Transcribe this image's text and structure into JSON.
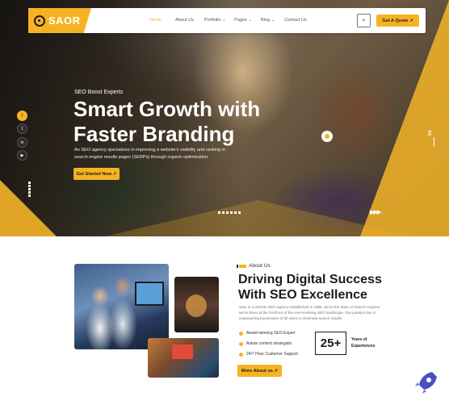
{
  "nav": {
    "logo_text": "SAOR",
    "items": [
      {
        "label": "Home",
        "active": true
      },
      {
        "label": "About Us",
        "active": false
      },
      {
        "label": "Portfolio",
        "active": false
      },
      {
        "label": "Pages",
        "active": false
      },
      {
        "label": "Blog",
        "active": false
      },
      {
        "label": "Contact Us",
        "active": false
      }
    ],
    "cta_label": "Get A Quote ↗",
    "search_icon": "search-icon"
  },
  "hero": {
    "eyebrow": "SEO Boost Experts",
    "title_line1": "Smart Growth with",
    "title_line2": "Faster Branding",
    "description": "An SEO agency specializes in improving a website's visibility and ranking in search engine results pages (SERPs) through organic optimization.",
    "button_label": "Get Started Now ↗",
    "slide_number": "03",
    "socials": [
      {
        "name": "facebook-icon",
        "glyph": "f"
      },
      {
        "name": "twitter-icon",
        "glyph": "t"
      },
      {
        "name": "linkedin-icon",
        "glyph": "in"
      },
      {
        "name": "youtube-icon",
        "glyph": "▶"
      }
    ]
  },
  "about": {
    "tag": "About Us",
    "title": "Driving Digital Success With SEO Excellence",
    "description": "Saor is a veteran SEO agency established in 1996. Since the dawn of search engines, we've been at the forefront of the ever-evolving SEO landscape. Our passion lies in empowering businesses of all sizes to dominate search results.",
    "checks": [
      "Award-winning SEO Expert",
      "Astute content strategists",
      "24/7 Hour Customer Support"
    ],
    "stat_value": "25+",
    "stat_label": "Years of Experiences",
    "button_label": "More About us ↗"
  },
  "colors": {
    "accent": "#f5b324",
    "dark": "#1b1b1b"
  }
}
